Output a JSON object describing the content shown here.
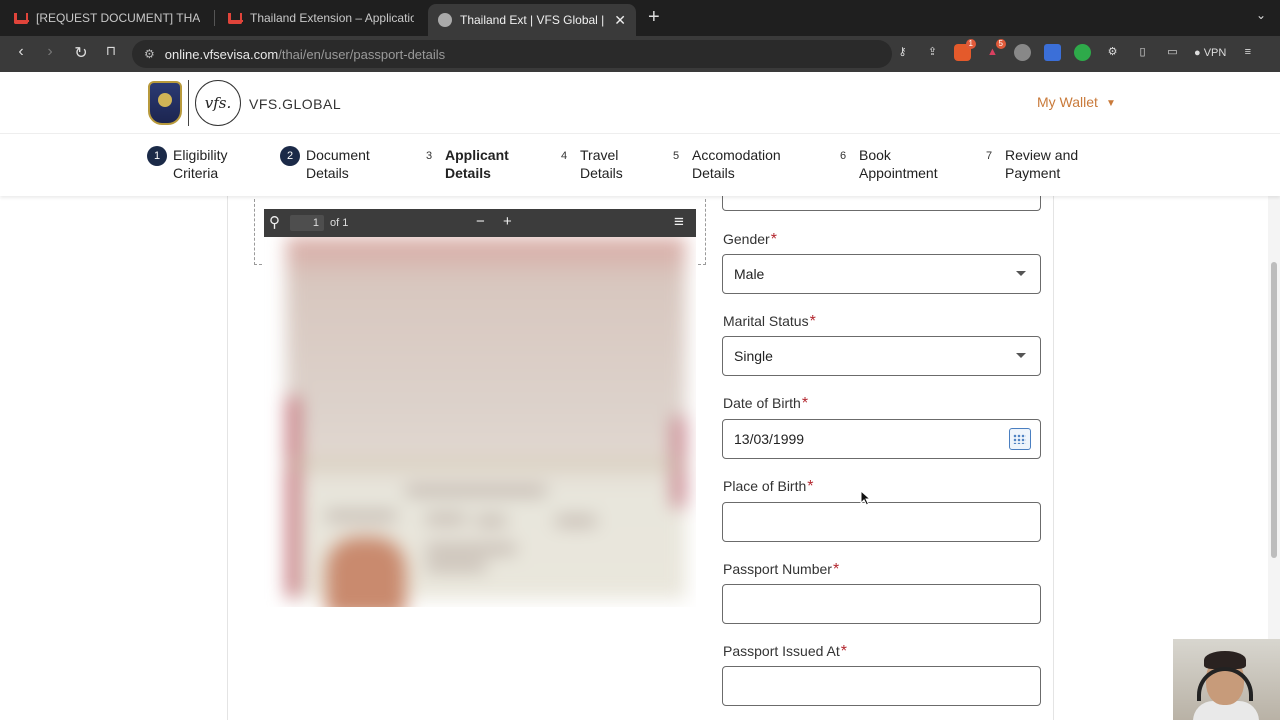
{
  "browser": {
    "tabs": [
      {
        "title": "[REQUEST DOCUMENT] THAR SE",
        "icon": "gmail-icon"
      },
      {
        "title": "Thailand Extension – Application R",
        "icon": "gmail-icon"
      },
      {
        "title": "Thailand Ext | VFS Global | Offi",
        "icon": "vfs-icon",
        "active": true
      }
    ],
    "address": {
      "host": "online.vfsevisa.com",
      "path": "/thai/en/user/passport-details"
    },
    "badges": {
      "brave": "1",
      "rewards": "5"
    },
    "vpn_label": "VPN"
  },
  "header": {
    "logo_mark": "vfs.",
    "logo_text": "VFS.GLOBAL",
    "wallet_label": "My Wallet"
  },
  "steps": [
    {
      "num": "1",
      "line1": "Eligibility",
      "line2": "Criteria",
      "state": "done"
    },
    {
      "num": "2",
      "line1": "Document",
      "line2": "Details",
      "state": "done"
    },
    {
      "num": "3",
      "line1": "Applicant",
      "line2": "Details",
      "state": "current"
    },
    {
      "num": "4",
      "line1": "Travel",
      "line2": "Details",
      "state": "todo"
    },
    {
      "num": "5",
      "line1": "Accomodation",
      "line2": "Details",
      "state": "todo"
    },
    {
      "num": "6",
      "line1": "Book",
      "line2": "Appointment",
      "state": "todo"
    },
    {
      "num": "7",
      "line1": "Review and",
      "line2": "Payment",
      "state": "todo"
    }
  ],
  "pdf_viewer": {
    "page": "1",
    "of_label": "of 1"
  },
  "form": {
    "required_mark": "*",
    "gender": {
      "label": "Gender",
      "value": "Male"
    },
    "marital_status": {
      "label": "Marital Status",
      "value": "Single"
    },
    "date_of_birth": {
      "label": "Date of Birth",
      "value": "13/03/1999"
    },
    "place_of_birth": {
      "label": "Place of Birth",
      "value": ""
    },
    "passport_number": {
      "label": "Passport Number",
      "value": ""
    },
    "passport_issued_at": {
      "label": "Passport Issued At",
      "value": ""
    }
  },
  "colors": {
    "accent": "#c97a3a",
    "step_done": "#1b2a48",
    "required": "#b3262e"
  }
}
